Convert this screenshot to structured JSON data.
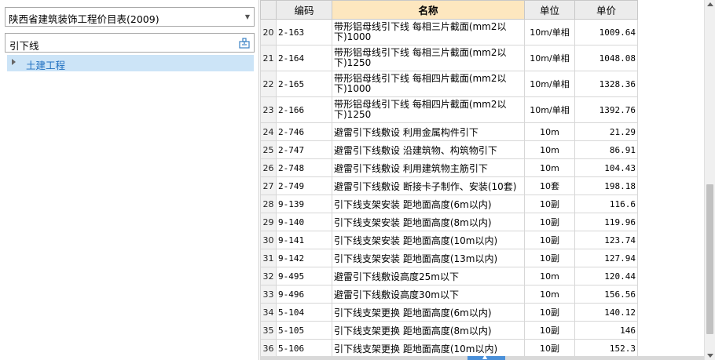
{
  "left_panel": {
    "library_select": {
      "value": "陕西省建筑装饰工程价目表(2009)"
    },
    "search": {
      "value": "引下线",
      "button_icon": "search-structure-icon"
    },
    "tree": [
      {
        "label": "土建工程",
        "selected": true
      }
    ]
  },
  "grid": {
    "columns": [
      "",
      "编码",
      "名称",
      "单位",
      "单价"
    ],
    "rows": [
      {
        "no": "20",
        "code": "2-163",
        "name": "带形铝母线引下线 每相三片截面(mm2以下)1000",
        "unit": "10m/单相",
        "price": "1009.64"
      },
      {
        "no": "21",
        "code": "2-164",
        "name": "带形铝母线引下线 每相三片截面(mm2以下)1250",
        "unit": "10m/单相",
        "price": "1048.08"
      },
      {
        "no": "22",
        "code": "2-165",
        "name": "带形铝母线引下线 每相四片截面(mm2以下)1000",
        "unit": "10m/单相",
        "price": "1328.36"
      },
      {
        "no": "23",
        "code": "2-166",
        "name": "带形铝母线引下线 每相四片截面(mm2以下)1250",
        "unit": "10m/单相",
        "price": "1392.76"
      },
      {
        "no": "24",
        "code": "2-746",
        "name": "避雷引下线敷设 利用金属构件引下",
        "unit": "10m",
        "price": "21.29"
      },
      {
        "no": "25",
        "code": "2-747",
        "name": "避雷引下线敷设 沿建筑物、构筑物引下",
        "unit": "10m",
        "price": "86.91"
      },
      {
        "no": "26",
        "code": "2-748",
        "name": "避雷引下线敷设 利用建筑物主筋引下",
        "unit": "10m",
        "price": "104.43"
      },
      {
        "no": "27",
        "code": "2-749",
        "name": "避雷引下线敷设 断接卡子制作、安装(10套)",
        "unit": "10套",
        "price": "198.18"
      },
      {
        "no": "28",
        "code": "9-139",
        "name": "引下线支架安装 距地面高度(6m以内)",
        "unit": "10副",
        "price": "116.6"
      },
      {
        "no": "29",
        "code": "9-140",
        "name": "引下线支架安装 距地面高度(8m以内)",
        "unit": "10副",
        "price": "119.96"
      },
      {
        "no": "30",
        "code": "9-141",
        "name": "引下线支架安装 距地面高度(10m以内)",
        "unit": "10副",
        "price": "123.74"
      },
      {
        "no": "31",
        "code": "9-142",
        "name": "引下线支架安装 距地面高度(13m以内)",
        "unit": "10副",
        "price": "127.94"
      },
      {
        "no": "32",
        "code": "9-495",
        "name": "避雷引下线敷设高度25m以下",
        "unit": "10m",
        "price": "120.44"
      },
      {
        "no": "33",
        "code": "9-496",
        "name": "避雷引下线敷设高度30m以下",
        "unit": "10m",
        "price": "156.56"
      },
      {
        "no": "34",
        "code": "5-104",
        "name": "引下线支架更换 距地面高度(6m以内)",
        "unit": "10副",
        "price": "140.12"
      },
      {
        "no": "35",
        "code": "5-105",
        "name": "引下线支架更换 距地面高度(8m以内)",
        "unit": "10副",
        "price": "146"
      },
      {
        "no": "36",
        "code": "5-106",
        "name": "引下线支架更换 距地面高度(10m以内)",
        "unit": "10副",
        "price": "152.3"
      }
    ]
  },
  "colors": {
    "name_header_bg": "#fde7bf",
    "tree_selected_bg": "#cce4f7",
    "tree_link": "#1e6fc0",
    "splitter_grip": "#4a90d9"
  }
}
